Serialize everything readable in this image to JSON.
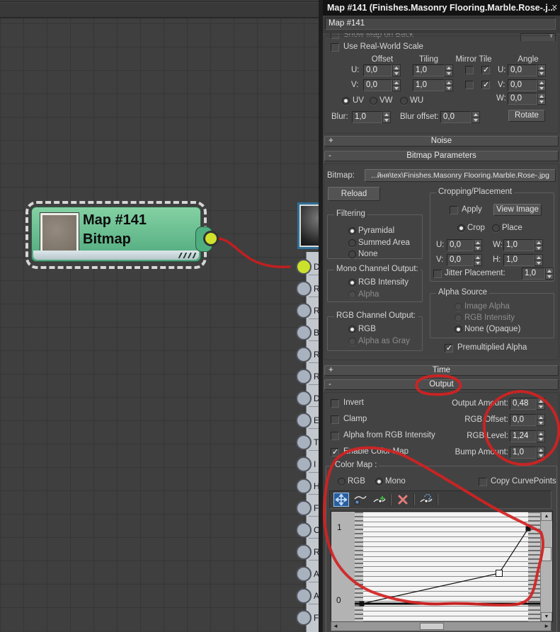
{
  "window": {
    "title": "Map #141 (Finishes.Masonry Flooring.Marble.Rose-.j...",
    "close_icon": "✕"
  },
  "name_field": {
    "value": "Map #141"
  },
  "clipped_row": {
    "label": "Show Map on Back",
    "dropdown_icon": "▼"
  },
  "coordinates": {
    "use_real_world_scale": "Use Real-World Scale",
    "offset_header": "Offset",
    "tiling_header": "Tiling",
    "mirror_tile_header": "Mirror Tile",
    "angle_header": "Angle",
    "u_label": "U:",
    "v_label": "V:",
    "w_label": "W:",
    "angle_u_label": "U:",
    "angle_v_label": "V:",
    "angle_w_label": "W:",
    "offset_u": "0,0",
    "offset_v": "0,0",
    "tiling_u": "1,0",
    "tiling_v": "1,0",
    "angle_u": "0,0",
    "angle_v": "0,0",
    "angle_w": "0,0",
    "uv": "UV",
    "vw": "VW",
    "wu": "WU",
    "blur_label": "Blur:",
    "blur": "1,0",
    "blur_offset_label": "Blur offset:",
    "blur_offset": "0,0",
    "rotate": "Rotate"
  },
  "rollouts": {
    "noise": {
      "sign": "+",
      "label": "Noise"
    },
    "bitmap_parameters": {
      "sign": "-",
      "label": "Bitmap Parameters"
    },
    "time": {
      "sign": "+",
      "label": "Time"
    },
    "output": {
      "sign": "-",
      "label": "Output"
    }
  },
  "bitmap": {
    "label": "Bitmap:",
    "path": "...йня\\tex\\Finishes.Masonry Flooring.Marble.Rose-.jpg",
    "reload": "Reload"
  },
  "cropping": {
    "title": "Cropping/Placement",
    "apply": "Apply",
    "view_image": "View Image",
    "crop": "Crop",
    "place": "Place",
    "u_label": "U:",
    "u": "0,0",
    "w_label": "W:",
    "w": "1,0",
    "v_label": "V:",
    "v": "0,0",
    "h_label": "H:",
    "h": "1,0",
    "jitter_label": "Jitter Placement:",
    "jitter": "1,0"
  },
  "filtering": {
    "title": "Filtering",
    "options": [
      "Pyramidal",
      "Summed Area",
      "None"
    ]
  },
  "mono_channel": {
    "title": "Mono Channel Output:",
    "options": [
      "RGB Intensity",
      "Alpha"
    ]
  },
  "rgb_channel": {
    "title": "RGB Channel Output:",
    "options": [
      "RGB",
      "Alpha as Gray"
    ]
  },
  "alpha_source": {
    "title": "Alpha Source",
    "options": [
      "Image Alpha",
      "RGB Intensity",
      "None (Opaque)"
    ]
  },
  "premultiplied_alpha": "Premultiplied Alpha",
  "output": {
    "invert": "Invert",
    "clamp": "Clamp",
    "alpha_from_rgb": "Alpha from RGB Intensity",
    "enable_color_map": "Enable Color Map",
    "output_amount_label": "Output Amount:",
    "output_amount": "0,48",
    "rgb_offset_label": "RGB Offset:",
    "rgb_offset": "0,0",
    "rgb_level_label": "RGB Level:",
    "rgb_level": "1,24",
    "bump_amount_label": "Bump Amount:",
    "bump_amount": "1,0"
  },
  "color_map": {
    "title": "Color Map :",
    "rgb": "RGB",
    "mono": "Mono",
    "copy_curvepoints": "Copy CurvePoints",
    "axis_top": "1",
    "axis_bottom": "0",
    "toolbar_icons": [
      "move-curve-point",
      "scale-curve-point",
      "add-curve-point",
      "delete-curve-point",
      "reset-curves"
    ],
    "curve_points": [
      {
        "x": 0,
        "y": 0
      },
      {
        "x": 0.83,
        "y": 0.41
      },
      {
        "x": 1,
        "y": 1.0
      }
    ]
  },
  "node": {
    "title": "Map #141",
    "subtitle": "Bitmap"
  },
  "material_node": {
    "sockets": [
      "D",
      "R",
      "R",
      "B",
      "R",
      "R",
      "D",
      "E",
      "T",
      "I",
      "H",
      "F",
      "O",
      "R",
      "A",
      "A",
      "F"
    ]
  },
  "scrollbars": {
    "up": "▲",
    "down": "▼",
    "left": "◄",
    "right": "►"
  },
  "colors": {
    "node_green": "#5dbd8b",
    "socket_yellow": "#cde12b",
    "wire_red": "#c11f1f",
    "annotation_red": "#d32222",
    "selection_white": "#d6d6d6"
  }
}
